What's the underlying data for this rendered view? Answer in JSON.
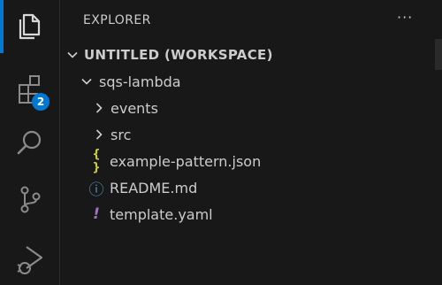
{
  "activity_bar": {
    "items": [
      {
        "icon": "files-icon",
        "active": true
      },
      {
        "icon": "extensions-icon",
        "badge": "2"
      },
      {
        "icon": "search-icon"
      },
      {
        "icon": "source-control-icon"
      },
      {
        "icon": "run-debug-icon"
      }
    ]
  },
  "explorer": {
    "title": "EXPLORER",
    "more_label": "···",
    "workspace": {
      "label": "UNTITLED (WORKSPACE)",
      "expanded": true
    },
    "tree": [
      {
        "label": "sqs-lambda",
        "kind": "folder",
        "expanded": true
      },
      {
        "label": "events",
        "kind": "folder",
        "expanded": false
      },
      {
        "label": "src",
        "kind": "folder",
        "expanded": false
      },
      {
        "label": "example-pattern.json",
        "kind": "file",
        "icon": "json-braces-icon",
        "icon_glyph": "{ }",
        "icon_color": "#cbcb41"
      },
      {
        "label": "README.md",
        "kind": "file",
        "icon": "info-icon",
        "icon_glyph": "ⓘ",
        "icon_color": "#519aba"
      },
      {
        "label": "template.yaml",
        "kind": "file",
        "icon": "yaml-exclamation-icon",
        "icon_glyph": "!",
        "icon_color": "#a074c4"
      }
    ]
  },
  "colors": {
    "accent": "#0078d4",
    "background": "#181818",
    "foreground": "#cccccc"
  }
}
